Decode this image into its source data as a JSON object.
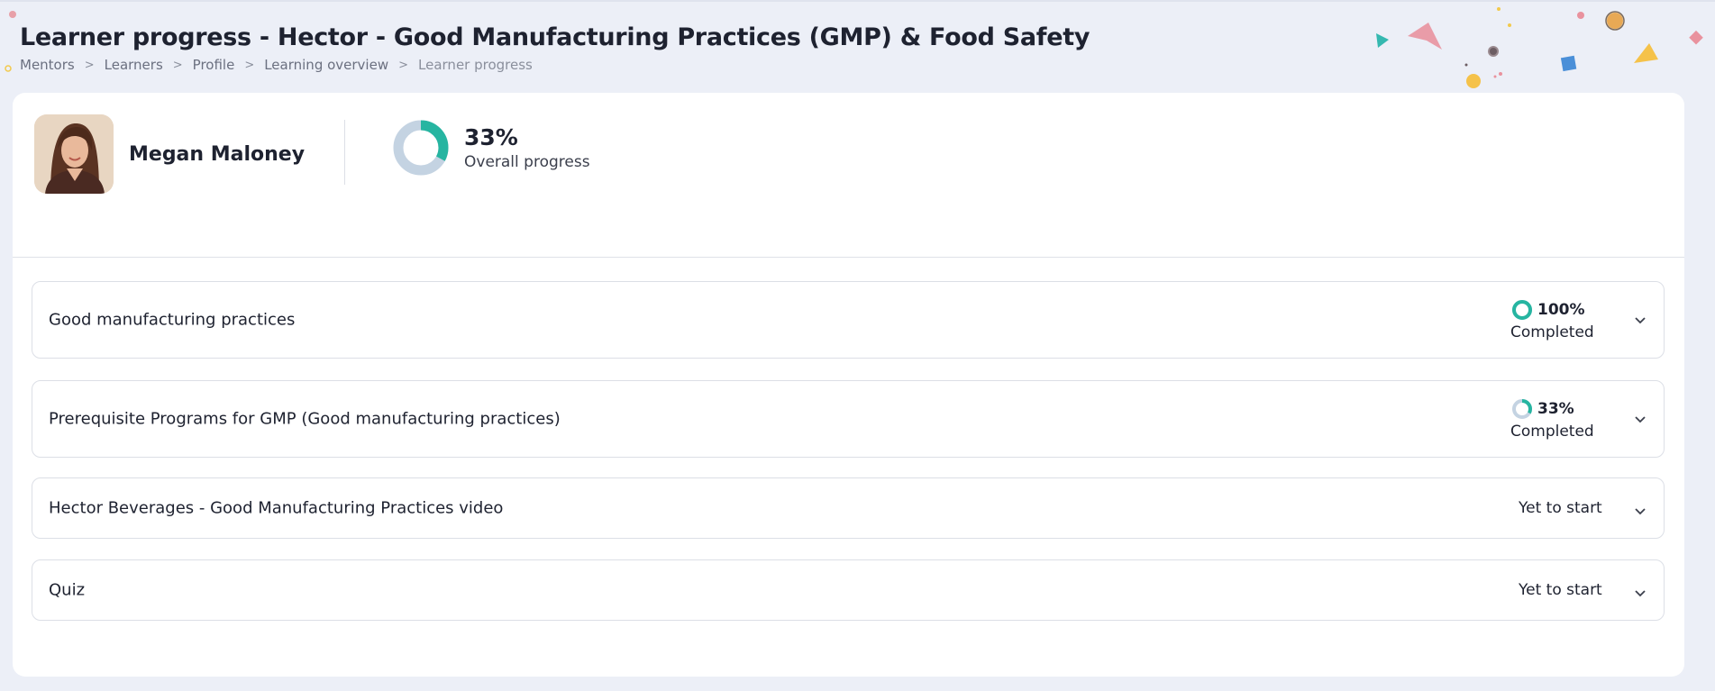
{
  "page": {
    "title": "Learner progress - Hector - Good Manufacturing Practices (GMP) & Food Safety"
  },
  "breadcrumb": [
    {
      "label": "Mentors"
    },
    {
      "label": "Learners"
    },
    {
      "label": "Profile"
    },
    {
      "label": "Learning overview"
    },
    {
      "label": "Learner progress"
    }
  ],
  "learner": {
    "name": "Megan Maloney",
    "avatar_icon": "person-photo"
  },
  "overall": {
    "percent_text": "33%",
    "label": "Overall progress",
    "progress": 0.33
  },
  "colors": {
    "accent": "#26b5a1",
    "track": "#c4d3e2",
    "background": "#eceff7"
  },
  "modules": [
    {
      "title": "Good manufacturing practices",
      "percent_text": "100%",
      "status": "Completed",
      "progress": 1.0
    },
    {
      "title": "Prerequisite Programs for GMP (Good manufacturing practices)",
      "percent_text": "33%",
      "status": "Completed",
      "progress": 0.33
    },
    {
      "title": "Hector Beverages - Good Manufacturing Practices video",
      "status": "Yet to start"
    },
    {
      "title": "Quiz",
      "status": "Yet to start"
    }
  ]
}
